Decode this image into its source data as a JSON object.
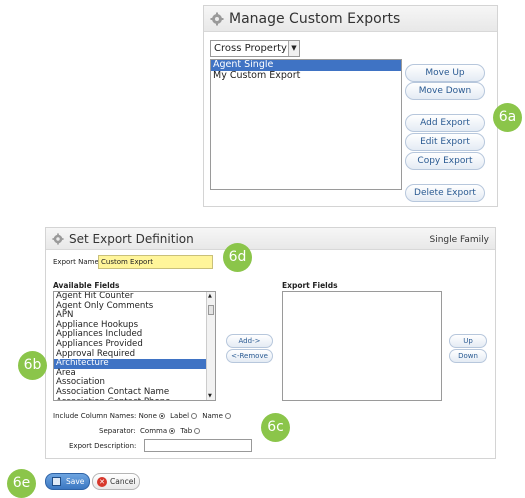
{
  "manage": {
    "title": "Manage Custom Exports",
    "dropdown_value": "Cross Property",
    "exports": [
      {
        "label": "Agent Single",
        "selected": true
      },
      {
        "label": "My Custom Export",
        "selected": false
      }
    ],
    "buttons": {
      "move_up": "Move Up",
      "move_down": "Move Down",
      "add_export": "Add Export",
      "edit_export": "Edit Export",
      "copy_export": "Copy Export",
      "delete_export": "Delete Export"
    }
  },
  "define": {
    "title": "Set Export Definition",
    "type_label": "Single Family",
    "export_name_label": "Export Name:",
    "export_name_value": "Custom Export",
    "available_fields_label": "Available Fields",
    "export_fields_label": "Export Fields",
    "available_fields": [
      {
        "label": "Agent Hit Counter",
        "selected": false
      },
      {
        "label": "Agent Only Comments",
        "selected": false
      },
      {
        "label": "APN",
        "selected": false
      },
      {
        "label": "Appliance Hookups",
        "selected": false
      },
      {
        "label": "Appliances Included",
        "selected": false
      },
      {
        "label": "Appliances Provided",
        "selected": false
      },
      {
        "label": "Approval Required",
        "selected": false
      },
      {
        "label": "Architecture",
        "selected": true
      },
      {
        "label": "Area",
        "selected": false
      },
      {
        "label": "Association",
        "selected": false
      },
      {
        "label": "Association Contact Name",
        "selected": false
      },
      {
        "label": "Association Contact Phone",
        "selected": false
      }
    ],
    "add_label": "Add->",
    "remove_label": "<-Remove",
    "up_label": "Up",
    "down_label": "Down",
    "include_column_names_label": "Include Column Names:",
    "column_opt_none": "None",
    "column_opt_label": "Label",
    "column_opt_name": "Name",
    "separator_label": "Separator:",
    "sep_comma": "Comma",
    "sep_tab": "Tab",
    "export_description_label": "Export Description:",
    "save_label": "Save",
    "cancel_label": "Cancel"
  },
  "callouts": {
    "c6a": "6a",
    "c6b": "6b",
    "c6c": "6c",
    "c6d": "6d",
    "c6e": "6e"
  },
  "colors": {
    "callout": "#8bc54a",
    "selection": "#3f73c4",
    "name_field_bg": "#fff59a",
    "button_text": "#2a5a92"
  }
}
